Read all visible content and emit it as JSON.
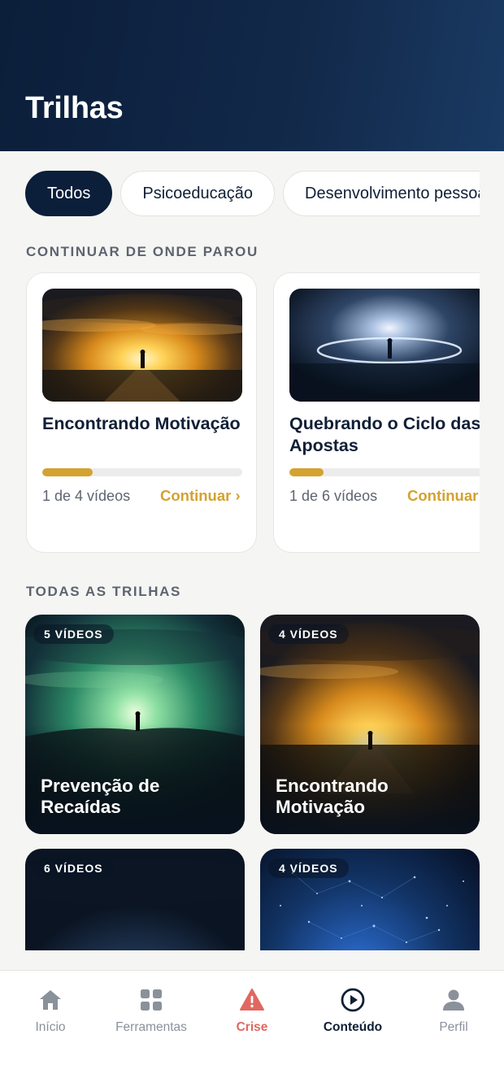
{
  "header": {
    "title": "Trilhas"
  },
  "filters": [
    {
      "label": "Todos",
      "active": true
    },
    {
      "label": "Psicoeducação",
      "active": false
    },
    {
      "label": "Desenvolvimento pessoal",
      "active": false
    }
  ],
  "continue_section": {
    "title": "CONTINUAR DE ONDE PAROU",
    "cards": [
      {
        "title": "Encontrando Motivação",
        "progress_text": "1 de 4 vídeos",
        "action": "Continuar ›",
        "progress": 0.25
      },
      {
        "title": "Quebrando o Ciclo das Apostas",
        "progress_text": "1 de 6 vídeos",
        "action": "Continuar ›",
        "progress": 0.17
      }
    ]
  },
  "all_section": {
    "title": "TODAS AS TRILHAS",
    "cards": [
      {
        "badge": "5 VÍDEOS",
        "title": "Prevenção de Recaídas"
      },
      {
        "badge": "4 VÍDEOS",
        "title": "Encontrando Motivação"
      },
      {
        "badge": "6 VÍDEOS",
        "title": ""
      },
      {
        "badge": "4 VÍDEOS",
        "title": ""
      }
    ]
  },
  "tabbar": {
    "items": [
      {
        "label": "Início",
        "icon": "home-icon"
      },
      {
        "label": "Ferramentas",
        "icon": "grid-icon"
      },
      {
        "label": "Crise",
        "icon": "warning-icon"
      },
      {
        "label": "Conteúdo",
        "icon": "play-circle-icon",
        "active": true
      },
      {
        "label": "Perfil",
        "icon": "user-icon"
      }
    ]
  },
  "colors": {
    "primary": "#0b1e3a",
    "accent": "#d4a22f",
    "crisis": "#e06860",
    "background": "#f5f5f3"
  }
}
